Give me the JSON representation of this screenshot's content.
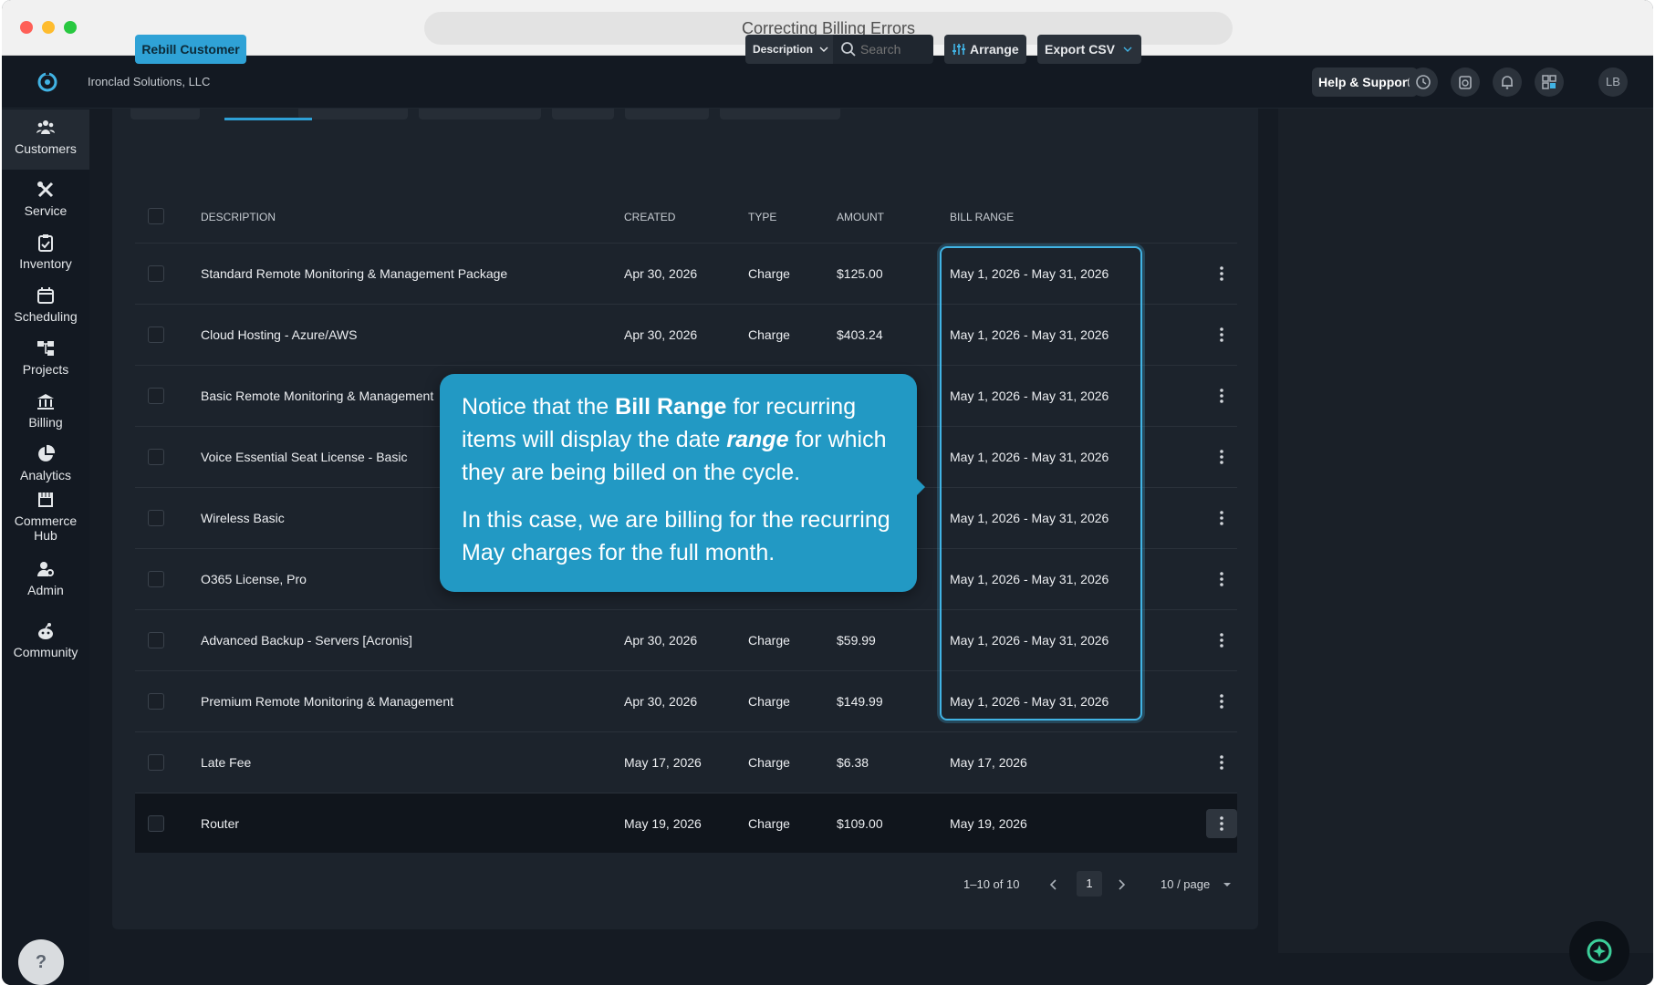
{
  "browser": {
    "title": "Correcting Billing Errors"
  },
  "topbar": {
    "company": "Ironclad Solutions, LLC",
    "help_label": "Help & Support",
    "avatar_initials": "LB"
  },
  "sidebar": {
    "items": [
      {
        "label": "Customers",
        "icon": "users-icon",
        "active": true
      },
      {
        "label": "Service",
        "icon": "tools-icon"
      },
      {
        "label": "Inventory",
        "icon": "clipboard-icon"
      },
      {
        "label": "Scheduling",
        "icon": "calendar-icon"
      },
      {
        "label": "Projects",
        "icon": "hierarchy-icon"
      },
      {
        "label": "Billing",
        "icon": "bank-icon"
      },
      {
        "label": "Analytics",
        "icon": "pie-chart-icon"
      },
      {
        "label": "Commerce",
        "label2": "Hub",
        "icon": "storefront-icon"
      },
      {
        "label": "Admin",
        "icon": "user-gear-icon"
      },
      {
        "label": "Community",
        "icon": "community-icon"
      }
    ],
    "help_glyph": "?"
  },
  "toolbar": {
    "rebill_label": "Rebill Customer",
    "filter_label": "Description",
    "search_placeholder": "Search",
    "arrange_label": "Arrange",
    "export_label": "Export CSV"
  },
  "table": {
    "headers": [
      "DESCRIPTION",
      "CREATED",
      "TYPE",
      "AMOUNT",
      "BILL RANGE"
    ],
    "rows": [
      {
        "description": "Standard Remote Monitoring & Management Package",
        "created": "Apr 30, 2026",
        "type": "Charge",
        "amount": "$125.00",
        "bill_range": "May 1, 2026 - May 31, 2026"
      },
      {
        "description": "Cloud Hosting - Azure/AWS",
        "created": "Apr 30, 2026",
        "type": "Charge",
        "amount": "$403.24",
        "bill_range": "May 1, 2026 - May 31, 2026"
      },
      {
        "description": "Basic Remote Monitoring & Management",
        "created": "",
        "type": "",
        "amount": "",
        "bill_range": "May 1, 2026 - May 31, 2026"
      },
      {
        "description": "Voice Essential Seat License - Basic",
        "created": "",
        "type": "",
        "amount": "",
        "bill_range": "May 1, 2026 - May 31, 2026"
      },
      {
        "description": "Wireless Basic",
        "created": "",
        "type": "",
        "amount": "",
        "bill_range": "May 1, 2026 - May 31, 2026"
      },
      {
        "description": "O365 License, Pro",
        "created": "",
        "type": "",
        "amount": "",
        "bill_range": "May 1, 2026 - May 31, 2026"
      },
      {
        "description": "Advanced Backup - Servers [Acronis]",
        "created": "Apr 30, 2026",
        "type": "Charge",
        "amount": "$59.99",
        "bill_range": "May 1, 2026 - May 31, 2026"
      },
      {
        "description": "Premium Remote Monitoring & Management",
        "created": "Apr 30, 2026",
        "type": "Charge",
        "amount": "$149.99",
        "bill_range": "May 1, 2026 - May 31, 2026"
      },
      {
        "description": "Late Fee",
        "created": "May 17, 2026",
        "type": "Charge",
        "amount": "$6.38",
        "bill_range": "May 17, 2026"
      },
      {
        "description": "Router",
        "created": "May 19, 2026",
        "type": "Charge",
        "amount": "$109.00",
        "bill_range": "May 19, 2026"
      }
    ]
  },
  "callout": {
    "p1_a": "Notice that the ",
    "p1_bold": "Bill Range",
    "p1_b": " for recurring items will display the date ",
    "p1_italic": "range",
    "p1_c": " for which they are being billed on the cycle.",
    "p2": "In this case, we are billing for the recurring May charges for the full month."
  },
  "pagination": {
    "summary": "1–10 of 10",
    "current_page": "1",
    "page_size": "10 / page"
  },
  "colors": {
    "accent": "#2fa2d6",
    "callout": "#2299c4",
    "highlight": "#41b3e4"
  }
}
